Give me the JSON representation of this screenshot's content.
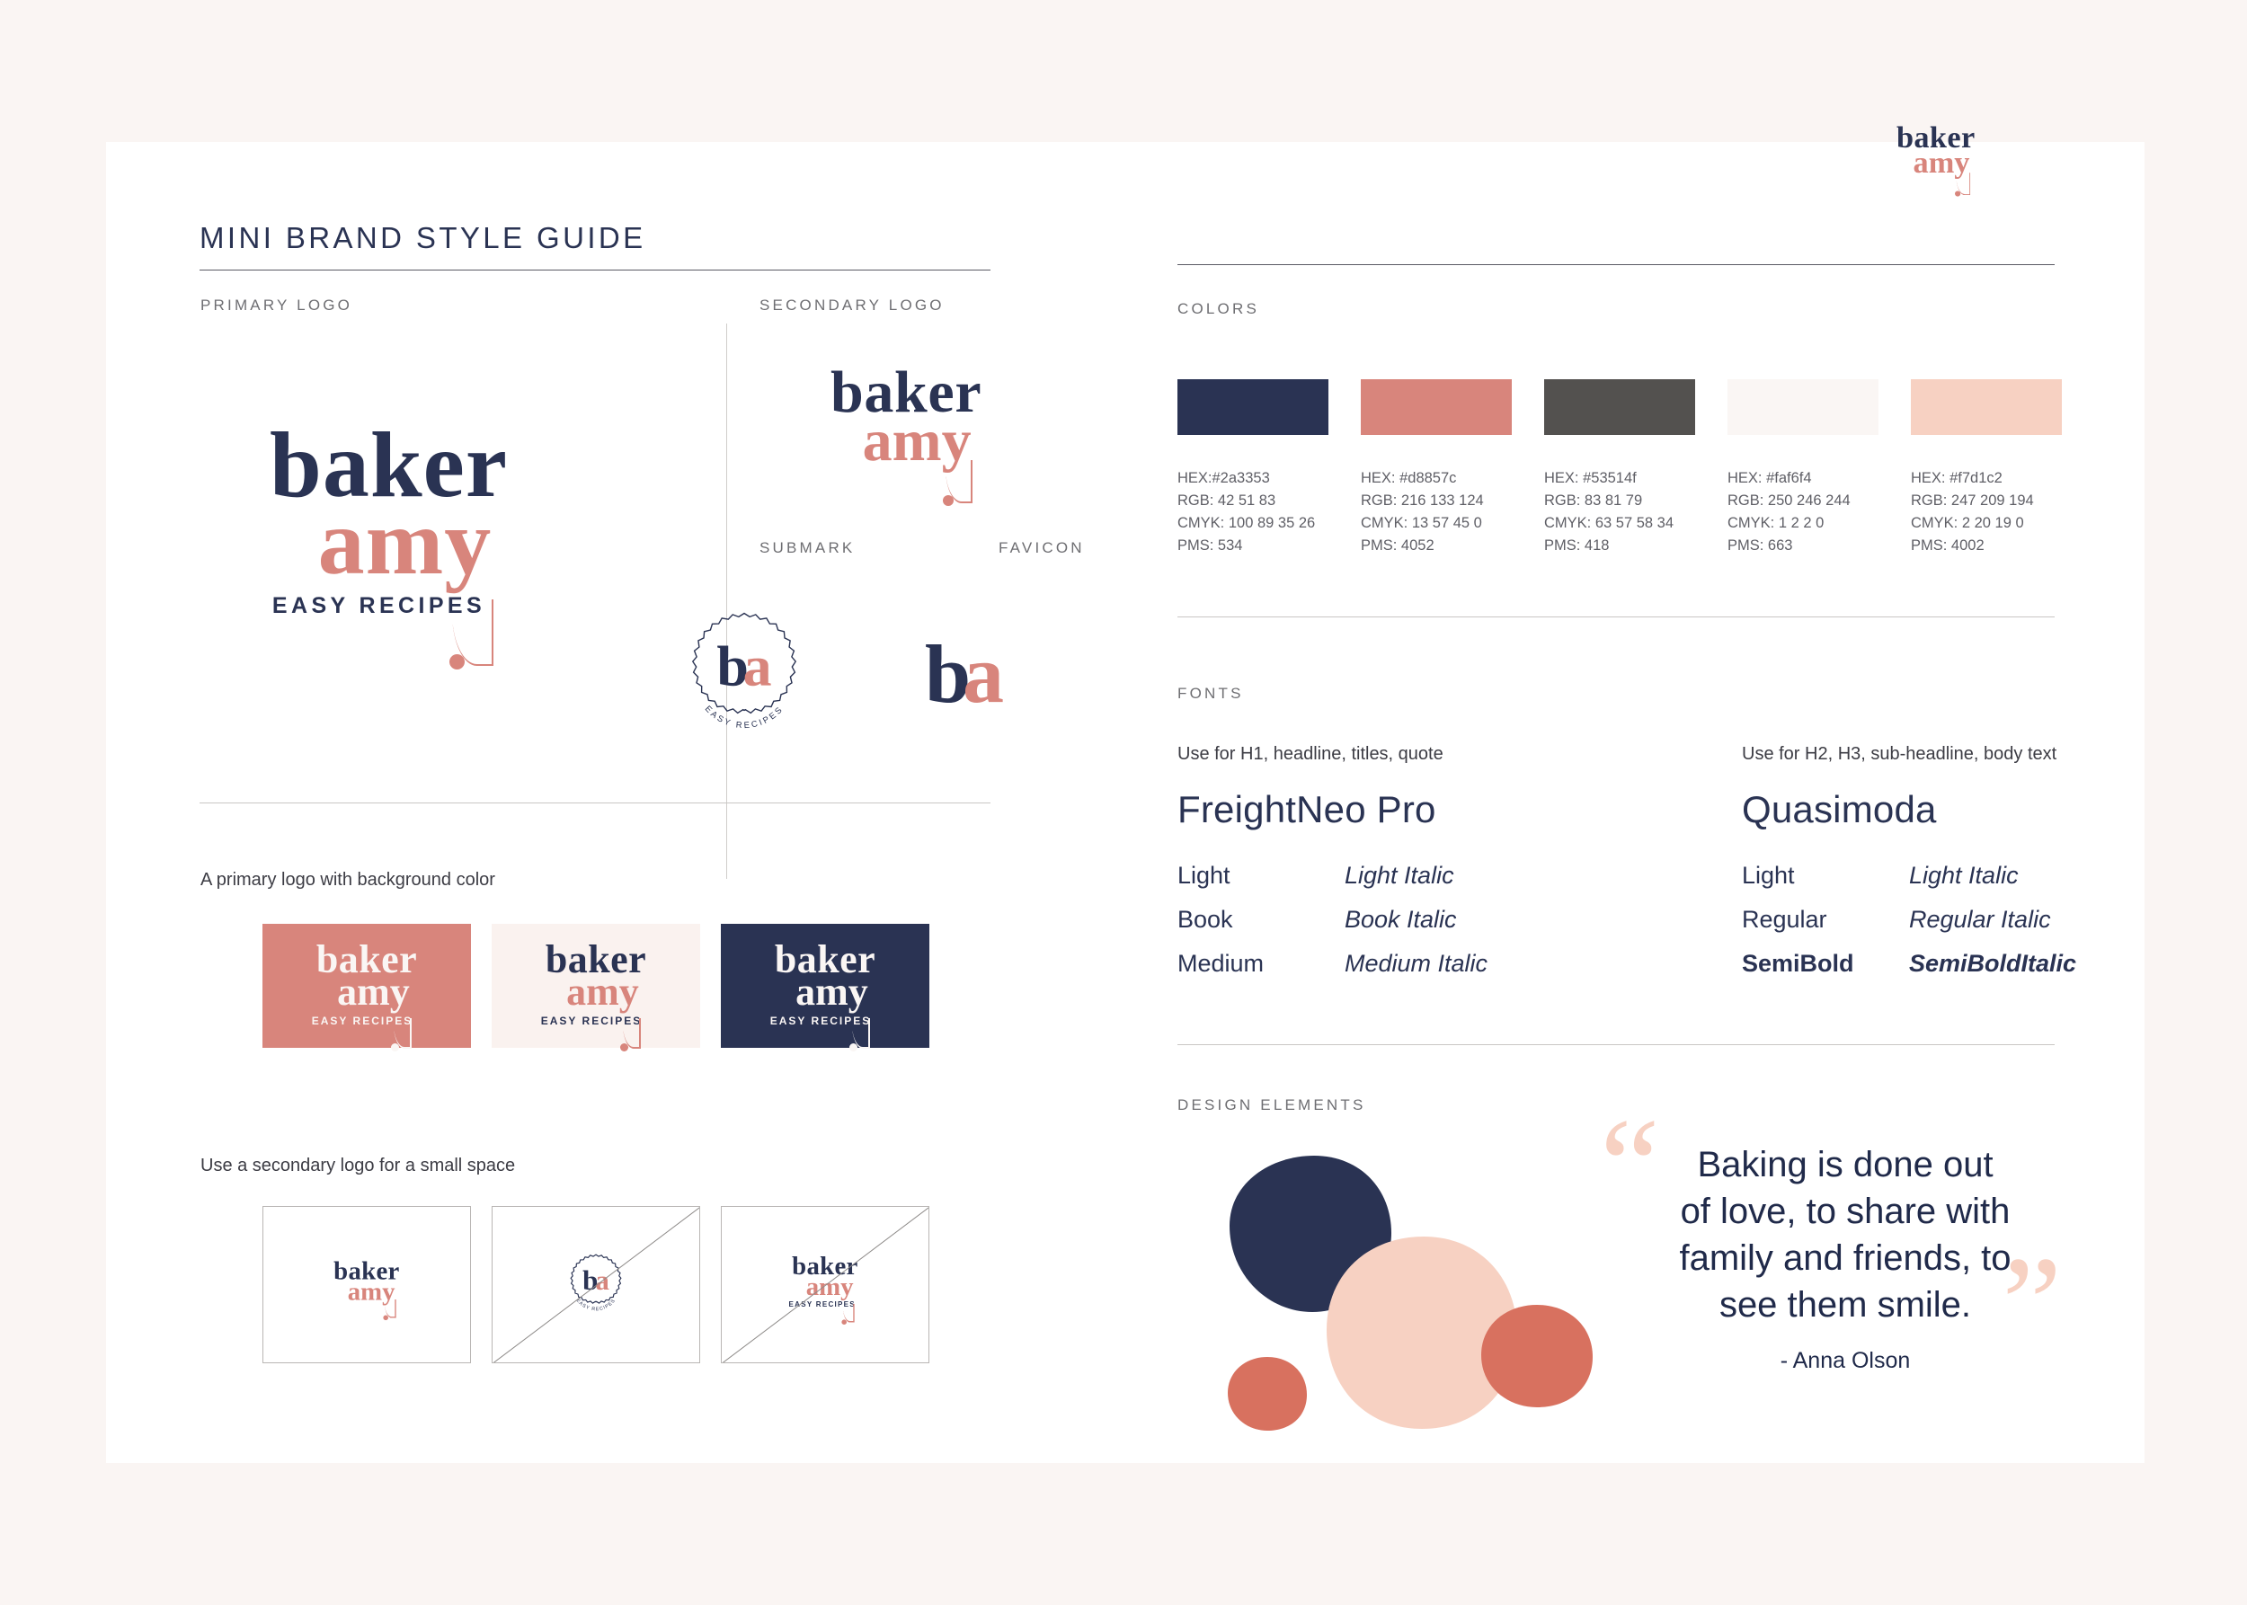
{
  "page": {
    "background_color": "#faf5f3",
    "card_color": "#ffffff"
  },
  "header": {
    "title": "MINI BRAND STYLE GUIDE",
    "brand_mark": {
      "line1": "baker",
      "line2": "amy"
    }
  },
  "brand": {
    "name_line1": "baker",
    "name_line2": "amy",
    "tagline": "EASY RECIPES",
    "monogram_b": "b",
    "monogram_a": "a",
    "badge_text": "EASY RECIPES"
  },
  "left": {
    "primary_logo_label": "PRIMARY LOGO",
    "secondary_logo_label": "SECONDARY LOGO",
    "submark_label": "SUBMARK",
    "favicon_label": "FAVICON",
    "bg_note": "A primary logo with background color",
    "small_space_note": "Use a secondary logo for a small space",
    "bg_swatches": [
      {
        "name": "coral",
        "bg": "#d8857c",
        "variant": "light"
      },
      {
        "name": "cream",
        "bg": "#faf2ef",
        "variant": "dark"
      },
      {
        "name": "navy",
        "bg": "#2a3353",
        "variant": "light"
      }
    ],
    "small_space_boxes": [
      {
        "name": "secondary-logo-ok",
        "mark": "secondary",
        "strike": false
      },
      {
        "name": "submark-too-small",
        "mark": "submark",
        "strike": true
      },
      {
        "name": "primary-logo-too-small",
        "mark": "primary",
        "strike": true
      }
    ]
  },
  "right": {
    "colors_label": "COLORS",
    "fonts_label": "FONTS",
    "design_elements_label": "DESIGN ELEMENTS",
    "colors": [
      {
        "swatch": "#2a3353",
        "hex": "HEX:#2a3353",
        "rgb": "RGB: 42 51 83",
        "cmyk": "CMYK: 100 89 35 26",
        "pms": "PMS: 534"
      },
      {
        "swatch": "#d8857c",
        "hex": "HEX: #d8857c",
        "rgb": "RGB: 216 133 124",
        "cmyk": "CMYK: 13 57 45 0",
        "pms": "PMS: 4052"
      },
      {
        "swatch": "#53514f",
        "hex": "HEX: #53514f",
        "rgb": "RGB: 83 81 79",
        "cmyk": "CMYK: 63 57 58 34",
        "pms": "PMS: 418"
      },
      {
        "swatch": "#faf6f4",
        "hex": "HEX: #faf6f4",
        "rgb": "RGB: 250 246 244",
        "cmyk": "CMYK: 1 2 2 0",
        "pms": "PMS: 663"
      },
      {
        "swatch": "#f7d1c2",
        "hex": "HEX: #f7d1c2",
        "rgb": "RGB: 247 209 194",
        "cmyk": "CMYK: 2 20 19 0",
        "pms": "PMS: 4002"
      }
    ],
    "fonts": [
      {
        "use": "Use for H1, headline, titles, quote",
        "family": "FreightNeo Pro",
        "weights": [
          {
            "roman": "Light",
            "italic": "Light Italic"
          },
          {
            "roman": "Book",
            "italic": "Book Italic"
          },
          {
            "roman": "Medium",
            "italic": "Medium Italic"
          }
        ]
      },
      {
        "use": "Use for H2, H3, sub-headline, body text",
        "family": "Quasimoda",
        "weights": [
          {
            "roman": "Light",
            "italic": "Light Italic"
          },
          {
            "roman": "Regular",
            "italic": "Regular Italic"
          },
          {
            "roman": "SemiBold",
            "italic": "SemiBoldItalic"
          }
        ]
      }
    ],
    "blobs": [
      {
        "name": "navy-blob",
        "color": "#2a3353"
      },
      {
        "name": "blush-blob",
        "color": "#f7d1c2"
      },
      {
        "name": "coral-blob-lg",
        "color": "#d8715f"
      },
      {
        "name": "coral-blob-sm",
        "color": "#d8715f"
      }
    ],
    "quote": {
      "open_mark": "“",
      "close_mark": "”",
      "lines": [
        "Baking is done out",
        "of love, to share with",
        "family and friends, to",
        "see them smile."
      ],
      "attribution": "- Anna Olson"
    }
  }
}
